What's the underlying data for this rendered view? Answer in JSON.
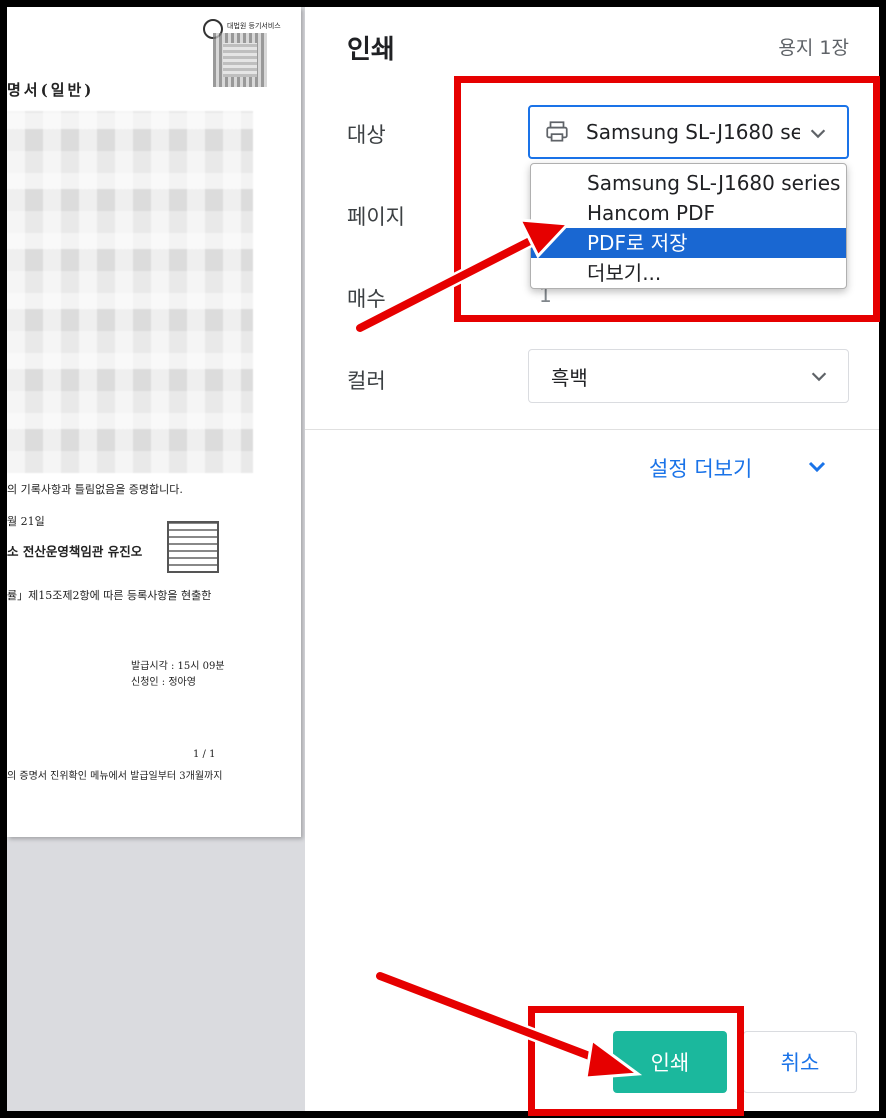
{
  "preview": {
    "logo_text": "대법원 등기서비스",
    "doc_title": "명서(일반)",
    "certify_line": "의 기록사항과 틀림없음을 증명합니다.",
    "date_line": "월 21일",
    "official_line": "소 전산운영책임관 유진오",
    "law_line": "률」제15조제2항에 따른 등록사항을 현출한",
    "issue_time": "발급시각 : 15시 09분",
    "applicant": "신청인 : 정아영",
    "page_num": "1 / 1",
    "footer_line": "의 증명서 진위확인 메뉴에서 발급일부터 3개월까지"
  },
  "print_panel": {
    "title": "인쇄",
    "sheet_count": "용지 1장",
    "destination": {
      "label": "대상",
      "value": "Samsung SL-J1680 se",
      "options": [
        "Samsung SL-J1680 series",
        "Hancom PDF",
        "PDF로 저장",
        "더보기..."
      ],
      "highlighted_option": "PDF로 저장"
    },
    "pages": {
      "label": "페이지"
    },
    "copies": {
      "label": "매수",
      "value": "1"
    },
    "color": {
      "label": "컬러",
      "value": "흑백"
    },
    "more_settings": "설정 더보기",
    "print_button": "인쇄",
    "cancel_button": "취소"
  },
  "colors": {
    "accent": "#1a73e8",
    "print_button": "#1bb89d",
    "highlight": "#1967d2",
    "annotation": "#e60000"
  }
}
